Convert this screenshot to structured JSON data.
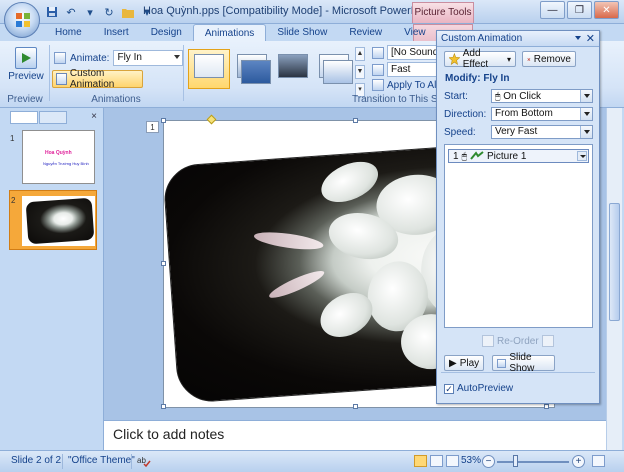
{
  "window": {
    "title": "Hoa Quỳnh.pps [Compatibility Mode] - Microsoft PowerPoint n...",
    "contextual_tab": "Picture Tools"
  },
  "ribbon": {
    "tabs": [
      "Home",
      "Insert",
      "Design",
      "Animations",
      "Slide Show",
      "Review",
      "View"
    ],
    "active_tab": "Animations",
    "preview_label": "Preview",
    "preview_group": "Preview",
    "animate_label": "Animate:",
    "animate_value": "Fly In",
    "custom_animation_label": "Custom Animation",
    "animations_group": "Animations",
    "sound_value": "[No Sound]",
    "speed_value": "Fast",
    "apply_all_label": "Apply To All",
    "transition_group": "Transition to This Slic"
  },
  "slides_pane": {
    "slide1_number": "1",
    "slide1_title": "Hoa Quỳnh",
    "slide1_subtitle": "Nguyễn Trường Huy Bình",
    "slide2_number": "2"
  },
  "editor": {
    "slide_badge": "1",
    "notes_placeholder": "Click to add notes"
  },
  "status": {
    "slide_info": "Slide 2 of 2",
    "theme": "\"Office Theme\"",
    "zoom": "53%"
  },
  "custom_animation": {
    "title": "Custom Animation",
    "add_effect": "Add Effect",
    "remove": "Remove",
    "modify_heading": "Modify: Fly In",
    "start_label": "Start:",
    "start_value": "On Click",
    "direction_label": "Direction:",
    "direction_value": "From Bottom",
    "speed_label": "Speed:",
    "speed_value": "Very Fast",
    "item_number": "1",
    "item_label": "Picture 1",
    "reorder_label": "Re-Order",
    "play_label": "Play",
    "slideshow_label": "Slide Show",
    "autopreview_label": "AutoPreview",
    "autopreview_checked": true
  },
  "colors": {
    "ribbon": "#d5e4f7",
    "selected": "#ffd46d",
    "contextual": "#eab4c2"
  }
}
